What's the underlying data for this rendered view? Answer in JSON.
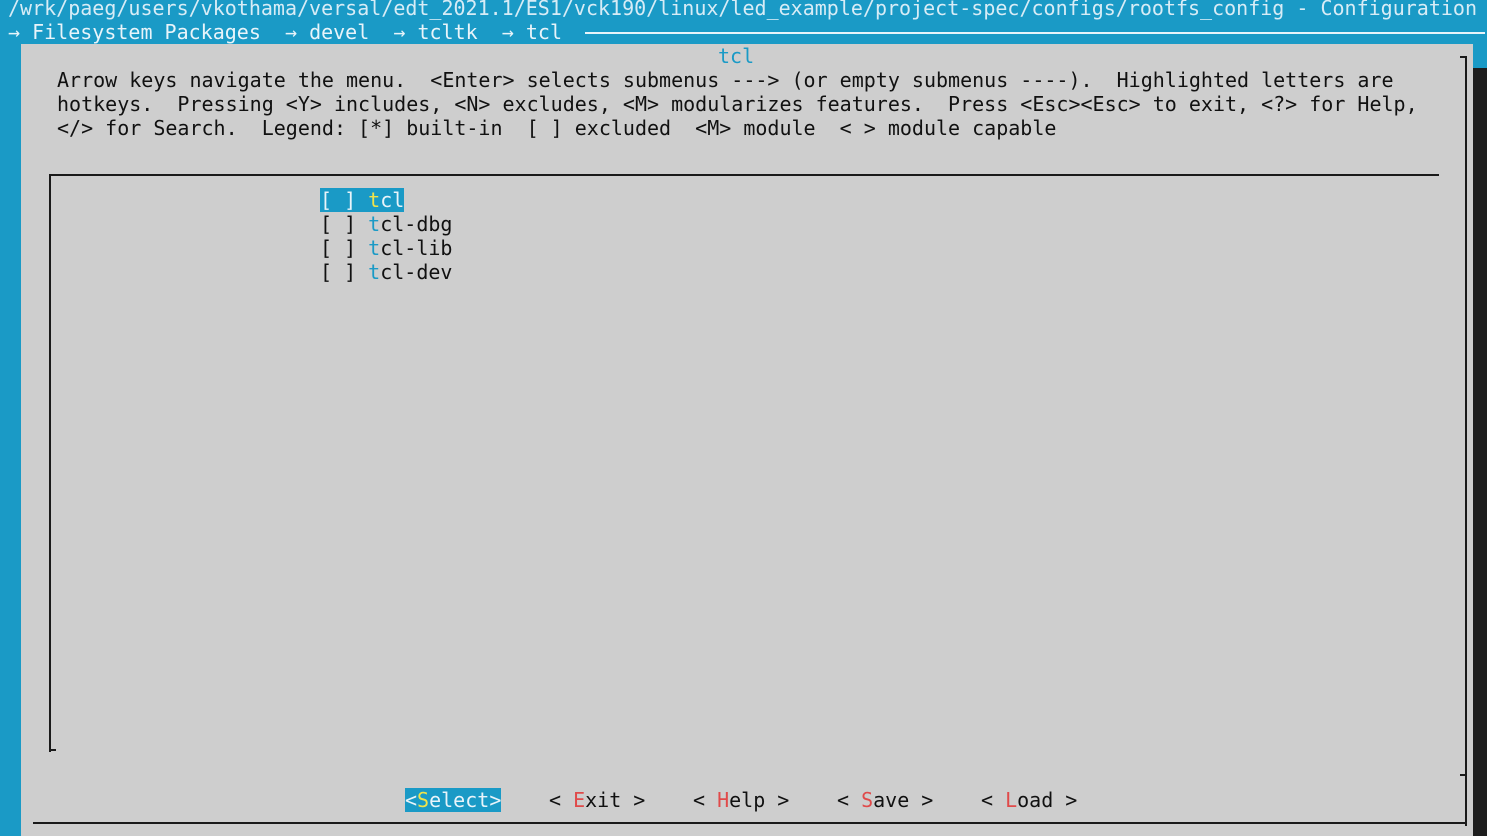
{
  "window": {
    "title": "/wrk/paeg/users/vkothama/versal/edt_2021.1/ES1/vck190/linux/led_example/project-spec/configs/rootfs_config - Configuration"
  },
  "breadcrumb": {
    "items": [
      "Filesystem Packages",
      "devel",
      "tcltk",
      "tcl"
    ],
    "separator": "→"
  },
  "dialog": {
    "title": "tcl",
    "help_lines": [
      "Arrow keys navigate the menu.  <Enter> selects submenus ---> (or empty submenus ----).  Highlighted letters are",
      "hotkeys.  Pressing <Y> includes, <N> excludes, <M> modularizes features.  Press <Esc><Esc> to exit, <?> for Help,",
      "</> for Search.  Legend: [*] built-in  [ ] excluded  <M> module  < > module capable"
    ]
  },
  "menu": {
    "items": [
      {
        "checkbox": "[ ]",
        "hotkey": "t",
        "rest": "cl",
        "selected": true
      },
      {
        "checkbox": "[ ]",
        "hotkey": "t",
        "rest": "cl-dbg",
        "selected": false
      },
      {
        "checkbox": "[ ]",
        "hotkey": "t",
        "rest": "cl-lib",
        "selected": false
      },
      {
        "checkbox": "[ ]",
        "hotkey": "t",
        "rest": "cl-dev",
        "selected": false
      }
    ]
  },
  "buttons": {
    "select": {
      "open": "<",
      "hotkey": "S",
      "rest": "elect",
      "close": ">"
    },
    "exit": {
      "open": "< ",
      "hotkey": "E",
      "rest": "xit",
      "close": " >"
    },
    "help": {
      "open": "< ",
      "hotkey": "H",
      "rest": "elp",
      "close": " >"
    },
    "save": {
      "open": "< ",
      "hotkey": "S",
      "rest": "ave",
      "close": " >"
    },
    "load": {
      "open": "< ",
      "hotkey": "L",
      "rest": "oad",
      "close": " >"
    }
  },
  "colors": {
    "background": "#1a9ac6",
    "dialog": "#cecece",
    "hotkey": "#1a9ac6",
    "button_hotkey": "#e04a4a",
    "selected_hotkey": "#f0e34a"
  }
}
